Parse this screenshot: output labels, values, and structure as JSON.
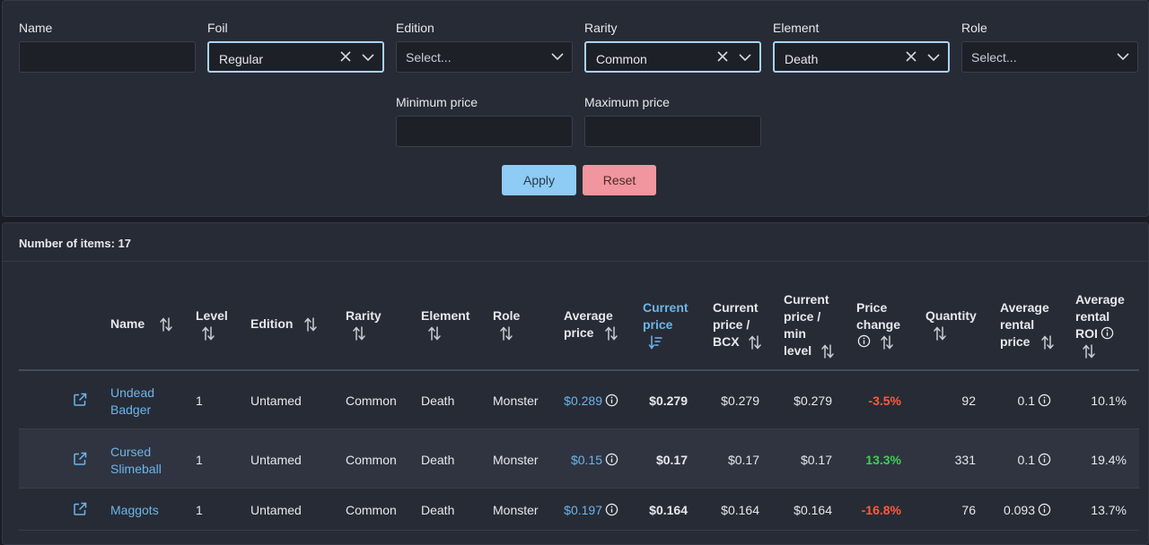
{
  "filters": {
    "name": {
      "label": "Name",
      "value": ""
    },
    "foil": {
      "label": "Foil",
      "value": "Regular"
    },
    "edition": {
      "label": "Edition",
      "placeholder": "Select..."
    },
    "rarity": {
      "label": "Rarity",
      "value": "Common"
    },
    "element": {
      "label": "Element",
      "value": "Death"
    },
    "role": {
      "label": "Role",
      "placeholder": "Select..."
    },
    "min_price": {
      "label": "Minimum price",
      "value": ""
    },
    "max_price": {
      "label": "Maximum price",
      "value": ""
    },
    "apply_label": "Apply",
    "reset_label": "Reset"
  },
  "results": {
    "count_label": "Number of items: 17",
    "headers": {
      "name": "Name",
      "level": "Level",
      "edition": "Edition",
      "rarity": "Rarity",
      "element": "Element",
      "role": "Role",
      "avg_price_1": "Average",
      "avg_price_2": "price",
      "cur_price_1": "Current",
      "cur_price_2": "price",
      "bcx_1": "Current",
      "bcx_2": "price /",
      "bcx_3": "BCX",
      "minlvl_1": "Current",
      "minlvl_2": "price /",
      "minlvl_3": "min",
      "minlvl_4": "level",
      "change_1": "Price",
      "change_2": "change",
      "quantity": "Quantity",
      "rent_1": "Average",
      "rent_2": "rental",
      "rent_3": "price",
      "roi_1": "Average",
      "roi_2": "rental",
      "roi_3": "ROI"
    },
    "rows": [
      {
        "name_1": "Undead",
        "name_2": "Badger",
        "level": "1",
        "edition": "Untamed",
        "rarity": "Common",
        "element": "Death",
        "role": "Monster",
        "avg_price": "$0.289",
        "cur_price": "$0.279",
        "bcx_price": "$0.279",
        "minlvl_price": "$0.279",
        "change": "-3.5%",
        "change_dir": "neg",
        "quantity": "92",
        "rental_price": "0.1",
        "roi": "10.1%"
      },
      {
        "name_1": "Cursed",
        "name_2": "Slimeball",
        "level": "1",
        "edition": "Untamed",
        "rarity": "Common",
        "element": "Death",
        "role": "Monster",
        "avg_price": "$0.15",
        "cur_price": "$0.17",
        "bcx_price": "$0.17",
        "minlvl_price": "$0.17",
        "change": "13.3%",
        "change_dir": "pos",
        "quantity": "331",
        "rental_price": "0.1",
        "roi": "19.4%"
      },
      {
        "name_1": "Maggots",
        "name_2": "",
        "level": "1",
        "edition": "Untamed",
        "rarity": "Common",
        "element": "Death",
        "role": "Monster",
        "avg_price": "$0.197",
        "cur_price": "$0.164",
        "bcx_price": "$0.164",
        "minlvl_price": "$0.164",
        "change": "-16.8%",
        "change_dir": "neg",
        "quantity": "76",
        "rental_price": "0.093",
        "roi": "13.7%"
      }
    ]
  },
  "colors": {
    "accent": "#6cb5ec",
    "apply": "#8ecbf5",
    "reset": "#f1959e",
    "negative": "#ff5a3c",
    "positive": "#3fcf55"
  },
  "icons": [
    "close-icon",
    "chevron-down-icon",
    "sort-icon",
    "sort-desc-icon",
    "info-icon",
    "external-link-icon"
  ]
}
